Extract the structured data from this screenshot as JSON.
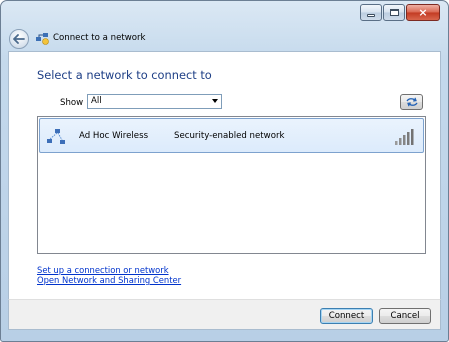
{
  "window": {
    "title": "Connect to a network",
    "controls": {
      "minimize": "minimize",
      "maximize": "maximize",
      "close": "×"
    }
  },
  "main": {
    "heading": "Select a network to connect to",
    "filter": {
      "label": "Show",
      "selected": "All"
    }
  },
  "networks": [
    {
      "name": "Ad Hoc Wireless",
      "security": "Security-enabled network",
      "signal_bars": 5,
      "icon": "adhoc-network-icon"
    }
  ],
  "links": {
    "setup": "Set up a connection or network",
    "sharing_center": "Open Network and Sharing Center"
  },
  "buttons": {
    "connect": "Connect",
    "cancel": "Cancel"
  },
  "colors": {
    "heading": "#1e3f86",
    "link": "#0033cc",
    "selected_row": "#dcebfc",
    "close_button": "#c23a22"
  }
}
